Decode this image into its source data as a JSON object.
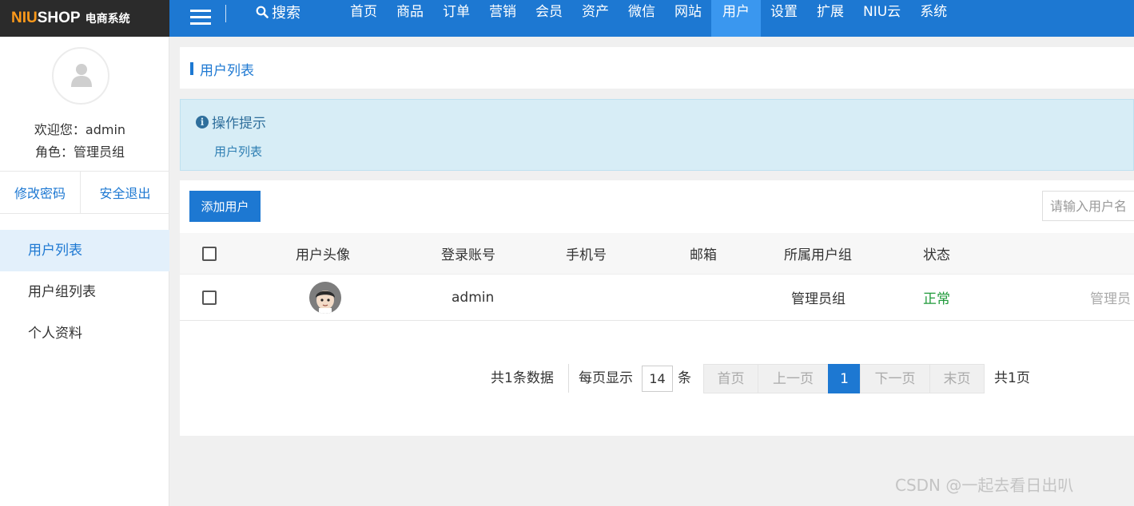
{
  "header": {
    "logo_main_a": "NIU",
    "logo_main_b": "SHOP",
    "logo_sub": "电商系统",
    "search_label": "搜索",
    "nav": [
      "首页",
      "商品",
      "订单",
      "营销",
      "会员",
      "资产",
      "微信",
      "网站",
      "用户",
      "设置",
      "扩展",
      "NIU云",
      "系统"
    ],
    "active_nav": "用户"
  },
  "sidebar": {
    "welcome": "欢迎您：admin",
    "role": "角色：管理员组",
    "change_password": "修改密码",
    "logout": "安全退出",
    "menu": [
      "用户列表",
      "用户组列表",
      "个人资料"
    ],
    "active_menu": "用户列表"
  },
  "breadcrumb": {
    "title": "用户列表"
  },
  "tip": {
    "title": "操作提示",
    "text": "用户列表"
  },
  "toolbar": {
    "add_label": "添加用户",
    "search_placeholder": "请输入用户名"
  },
  "table": {
    "columns": [
      "用户头像",
      "登录账号",
      "手机号",
      "邮箱",
      "所属用户组",
      "状态"
    ],
    "rows": [
      {
        "account": "admin",
        "phone": "",
        "email": "",
        "group": "管理员组",
        "status": "正常",
        "action": "管理员"
      }
    ]
  },
  "pagination": {
    "total_text": "共1条数据",
    "per_page_label": "每页显示",
    "per_page_value": "14",
    "per_page_unit": "条",
    "first": "首页",
    "prev": "上一页",
    "current": "1",
    "next": "下一页",
    "last": "末页",
    "pages_text": "共1页"
  },
  "watermark": "CSDN @一起去看日出叭",
  "colors": {
    "primary": "#1d78d2",
    "logo_bg": "#2b2b2b",
    "accent_orange": "#ff9a1a",
    "status_ok": "#1f9a3a",
    "tip_bg": "#d7edf6"
  }
}
